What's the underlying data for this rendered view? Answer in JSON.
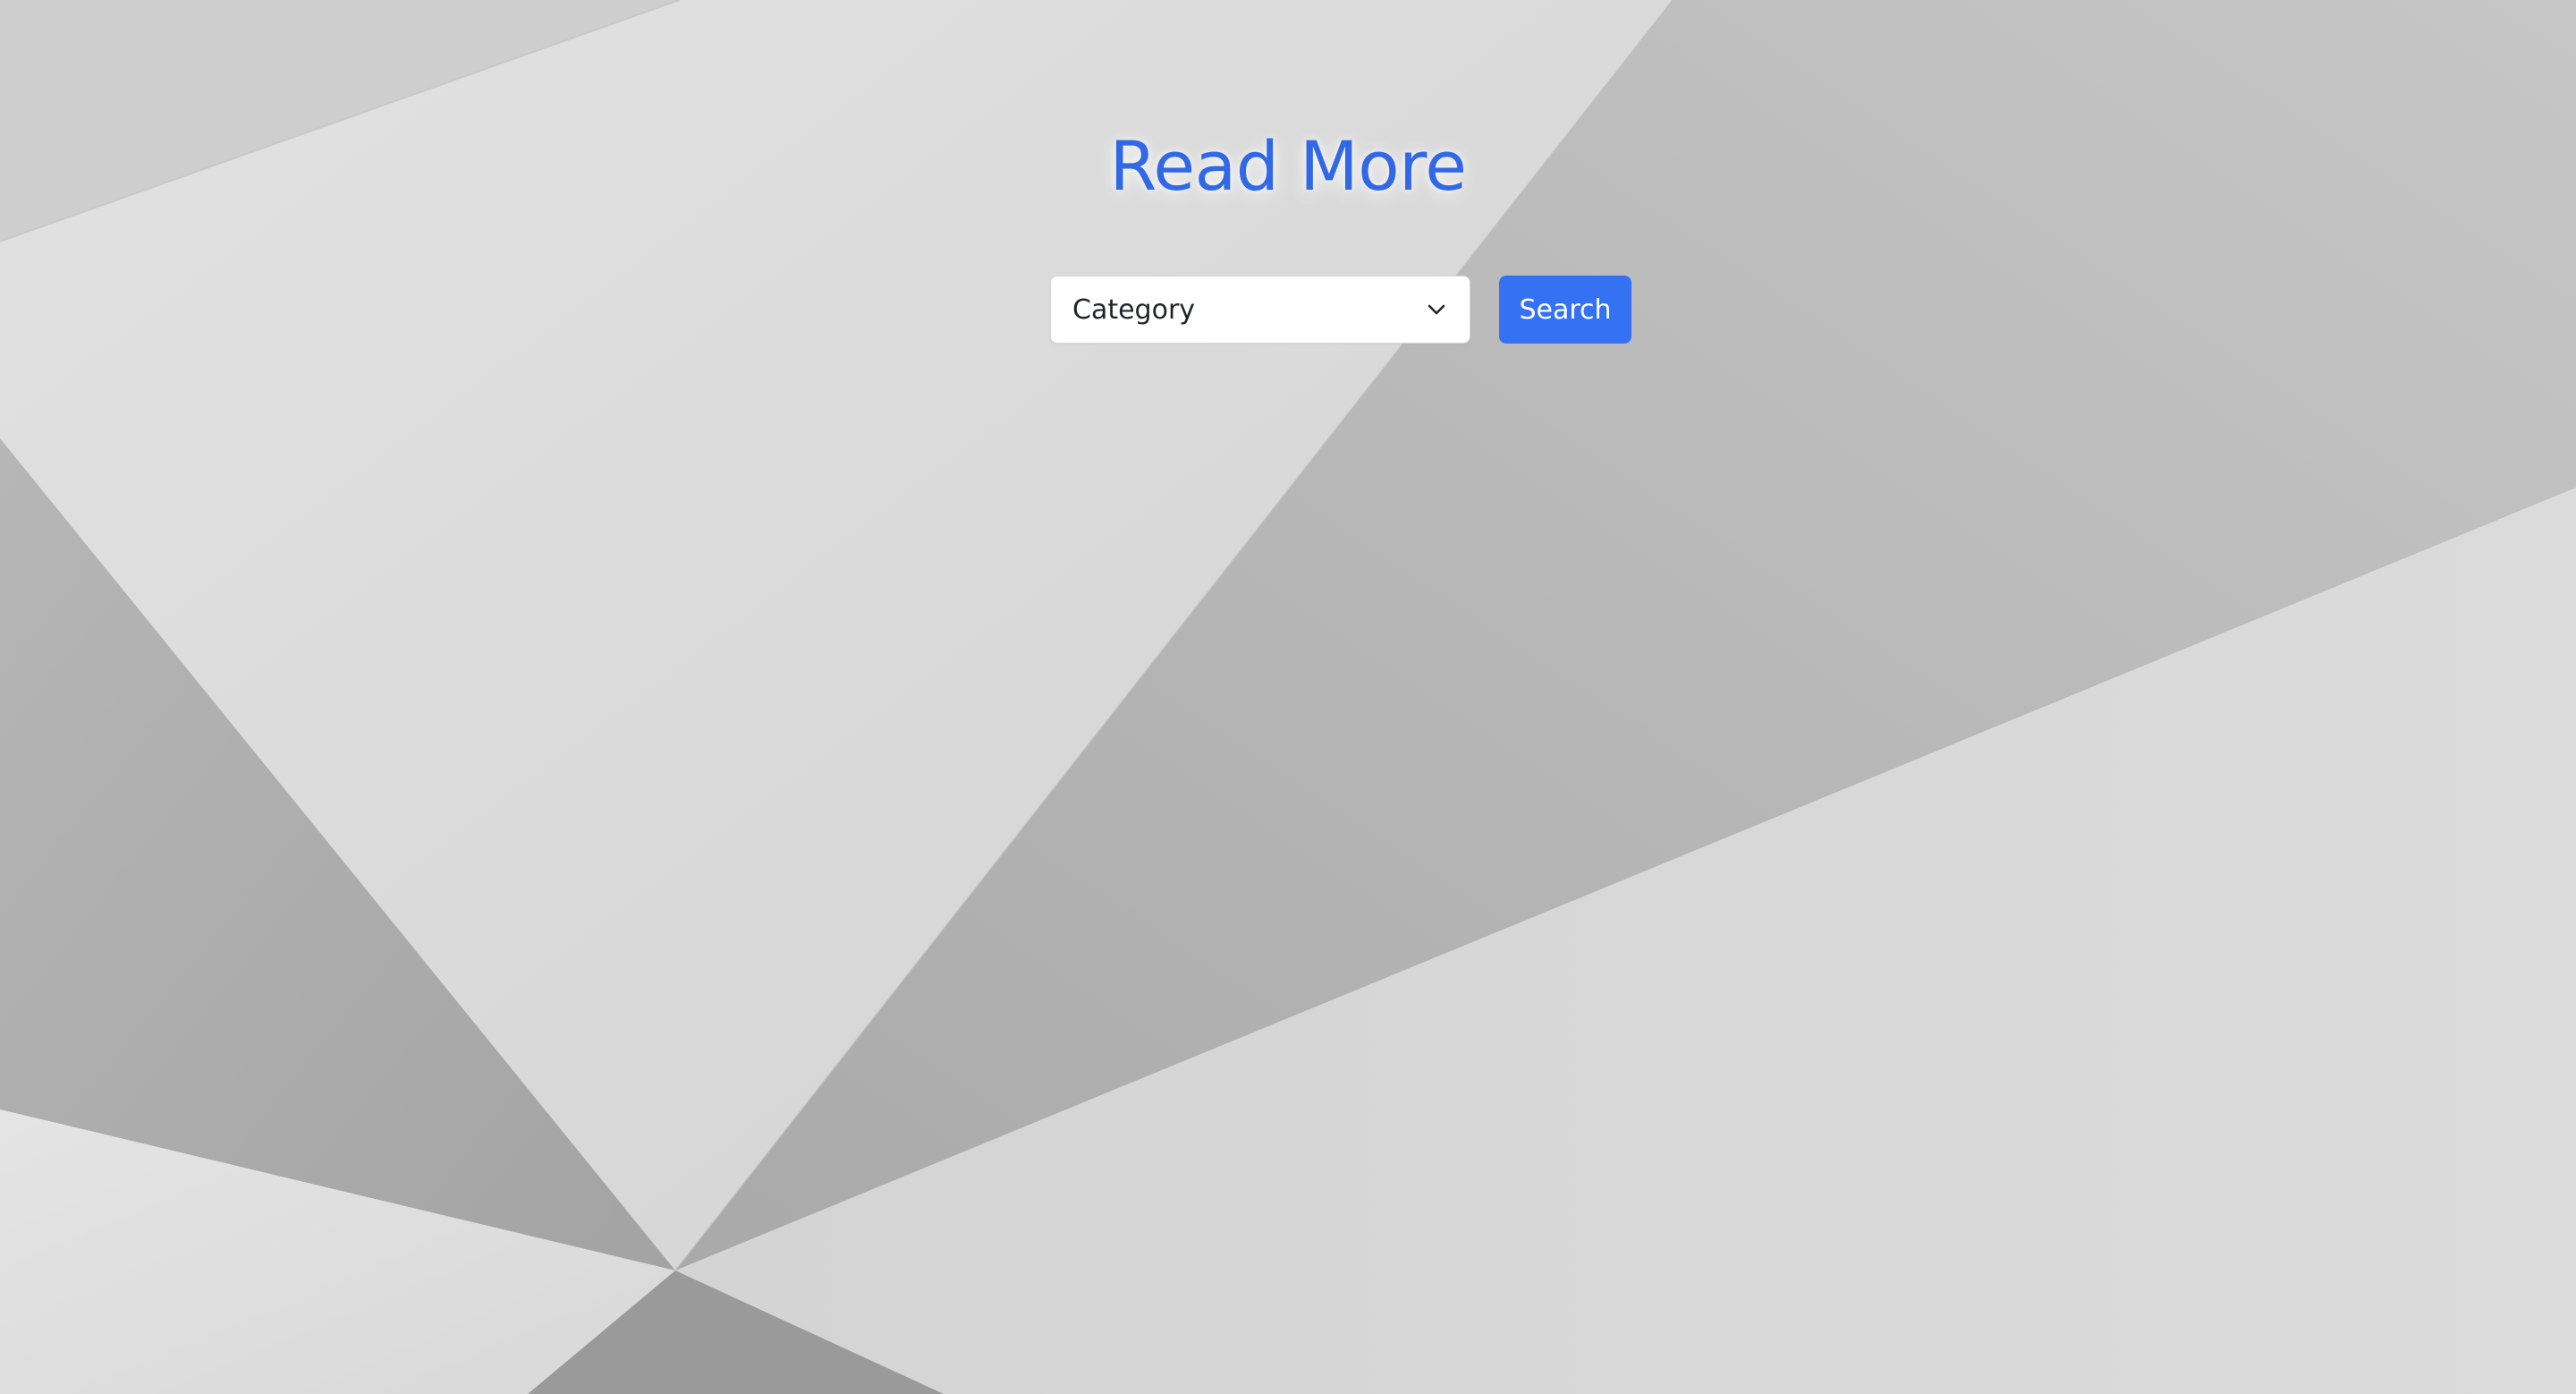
{
  "hero": {
    "title": "Read More",
    "background_image": "abstract-folded-paper"
  },
  "filter": {
    "category_select": {
      "selected_value": "Category",
      "icon": "chevron-down-icon"
    },
    "search_button_label": "Search"
  },
  "colors": {
    "title": "#3168e5",
    "button": "#3472f3",
    "button_text": "#ffffff"
  }
}
